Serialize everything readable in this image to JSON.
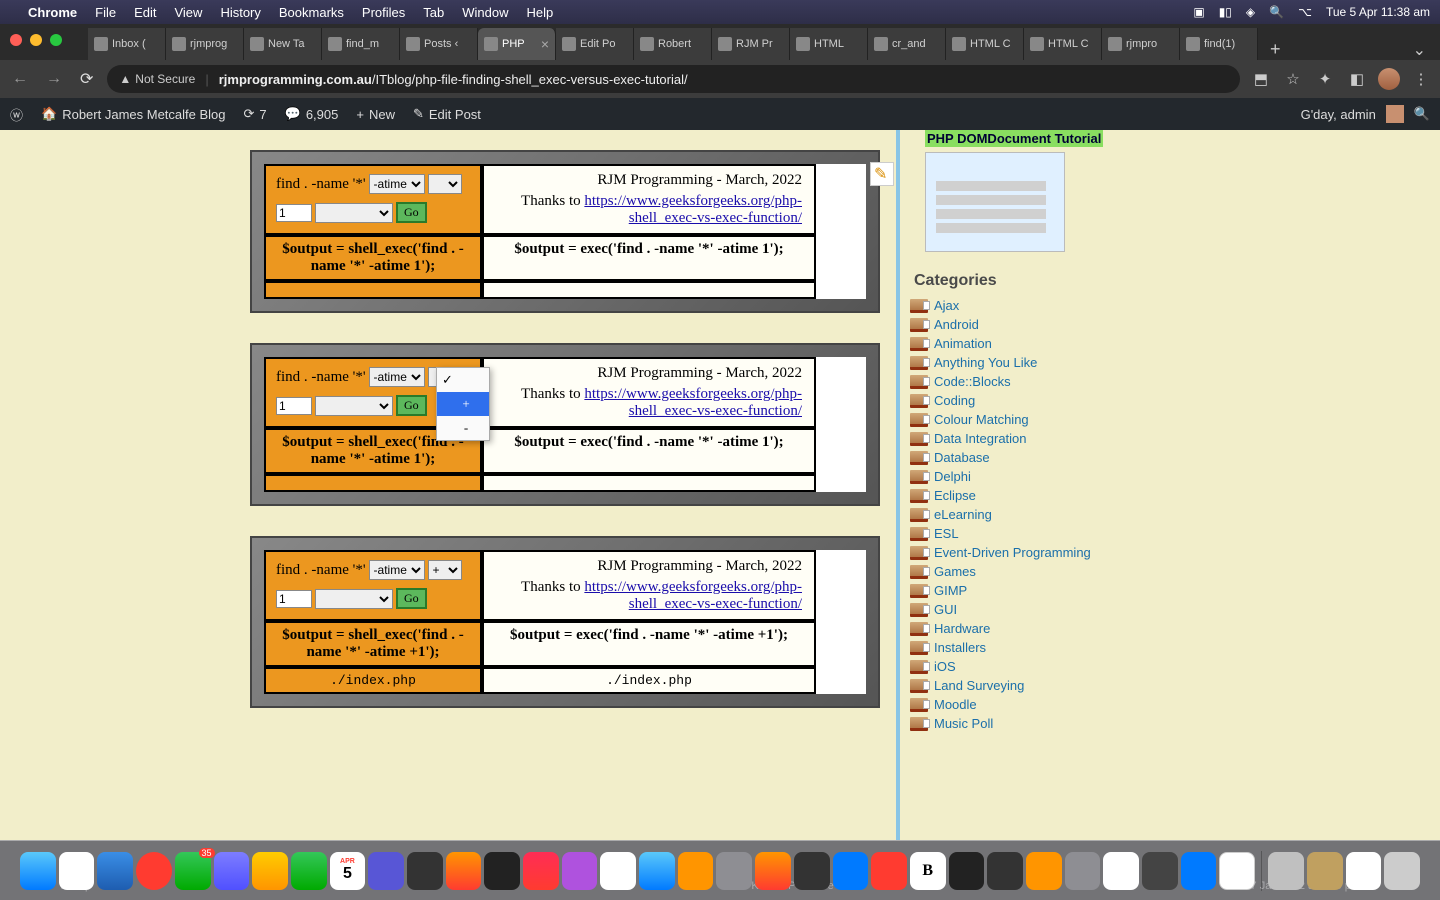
{
  "menubar": {
    "app": "Chrome",
    "items": [
      "File",
      "Edit",
      "View",
      "History",
      "Bookmarks",
      "Profiles",
      "Tab",
      "Window",
      "Help"
    ],
    "datetime": "Tue 5 Apr  11:38 am"
  },
  "tabs": [
    {
      "label": "Inbox (",
      "icon": "gmail"
    },
    {
      "label": "rjmprog",
      "icon": "rocket"
    },
    {
      "label": "New Ta",
      "icon": "globe"
    },
    {
      "label": "find_m",
      "icon": "globe"
    },
    {
      "label": "Posts ‹",
      "icon": "rocket"
    },
    {
      "label": "PHP",
      "icon": "rocket",
      "active": true
    },
    {
      "label": "Edit Po",
      "icon": "rocket"
    },
    {
      "label": "Robert",
      "icon": "circle"
    },
    {
      "label": "RJM Pr",
      "icon": "rocket"
    },
    {
      "label": "HTML",
      "icon": "page"
    },
    {
      "label": "cr_and",
      "icon": "rocket"
    },
    {
      "label": "HTML C",
      "icon": "rocket"
    },
    {
      "label": "HTML C",
      "icon": "rocket"
    },
    {
      "label": "rjmpro",
      "icon": "circle"
    },
    {
      "label": "find(1)",
      "icon": "globe"
    }
  ],
  "url": {
    "insecure": "Not Secure",
    "host": "rjmprogramming.com.au",
    "path": "/ITblog/php-file-finding-shell_exec-versus-exec-tutorial/"
  },
  "wpbar": {
    "site": "Robert James Metcalfe Blog",
    "refresh_count": "7",
    "comments": "6,905",
    "new": "New",
    "edit": "Edit Post",
    "greeting": "G'day, admin"
  },
  "modules": [
    {
      "find_text": "find . -name '*'",
      "atime_opt": "-atime",
      "n_value": "1",
      "go": "Go",
      "title": "RJM Programming - March, 2022",
      "thanks": "Thanks to ",
      "link": "https://www.geeksforgeeks.org/php-shell_exec-vs-exec-function/",
      "shell_out": "$output = shell_exec('find . -name '*' -atime 1');",
      "exec_out": "$output = exec('find . -name '*' -atime 1');",
      "result_l": "",
      "result_r": ""
    },
    {
      "find_text": "find . -name '*'",
      "atime_opt": "-atime",
      "n_value": "1",
      "go": "Go",
      "title": "RJM Programming - March, 2022",
      "thanks": "Thanks to ",
      "link": "https://www.geeksforgeeks.org/php-shell_exec-vs-exec-function/",
      "shell_out": "$output = shell_exec('find . -name '*' -atime 1');",
      "exec_out": "$output = exec('find . -name '*' -atime 1');",
      "result_l": "",
      "result_r": "",
      "dropdown": {
        "options": [
          "",
          "+",
          "-"
        ],
        "selected": 0,
        "highlighted": 1
      }
    },
    {
      "find_text": "find . -name '*'",
      "atime_opt": "-atime",
      "sign_opt": "+",
      "n_value": "1",
      "go": "Go",
      "title": "RJM Programming - March, 2022",
      "thanks": "Thanks to ",
      "link": "https://www.geeksforgeeks.org/php-shell_exec-vs-exec-function/",
      "shell_out": "$output = shell_exec('find . -name '*' -atime +1');",
      "exec_out": "$output = exec('find . -name '*' -atime +1');",
      "result_l": "./index.php",
      "result_r": "./index.php"
    }
  ],
  "sidebar": {
    "widget_title": "PHP DOMDocument Tutorial",
    "cats_hdr": "Categories",
    "categories": [
      "Ajax",
      "Android",
      "Animation",
      "Anything You Like",
      "Code::Blocks",
      "Coding",
      "Colour Matching",
      "Data Integration",
      "Database",
      "Delphi",
      "Eclipse",
      "eLearning",
      "ESL",
      "Event-Driven Programming",
      "Games",
      "GIMP",
      "GUI",
      "Hardware",
      "Installers",
      "iOS",
      "Land Surveying",
      "Moodle",
      "Music Poll"
    ]
  },
  "behind_dock": {
    "left": "we.zip",
    "mid": "351 KB – ZIP archive",
    "right": "17 Jan 2022 at 7:45 pm"
  },
  "dock_badges": {
    "messages": "35",
    "calendar_day": "5",
    "calendar_mon": "APR"
  }
}
